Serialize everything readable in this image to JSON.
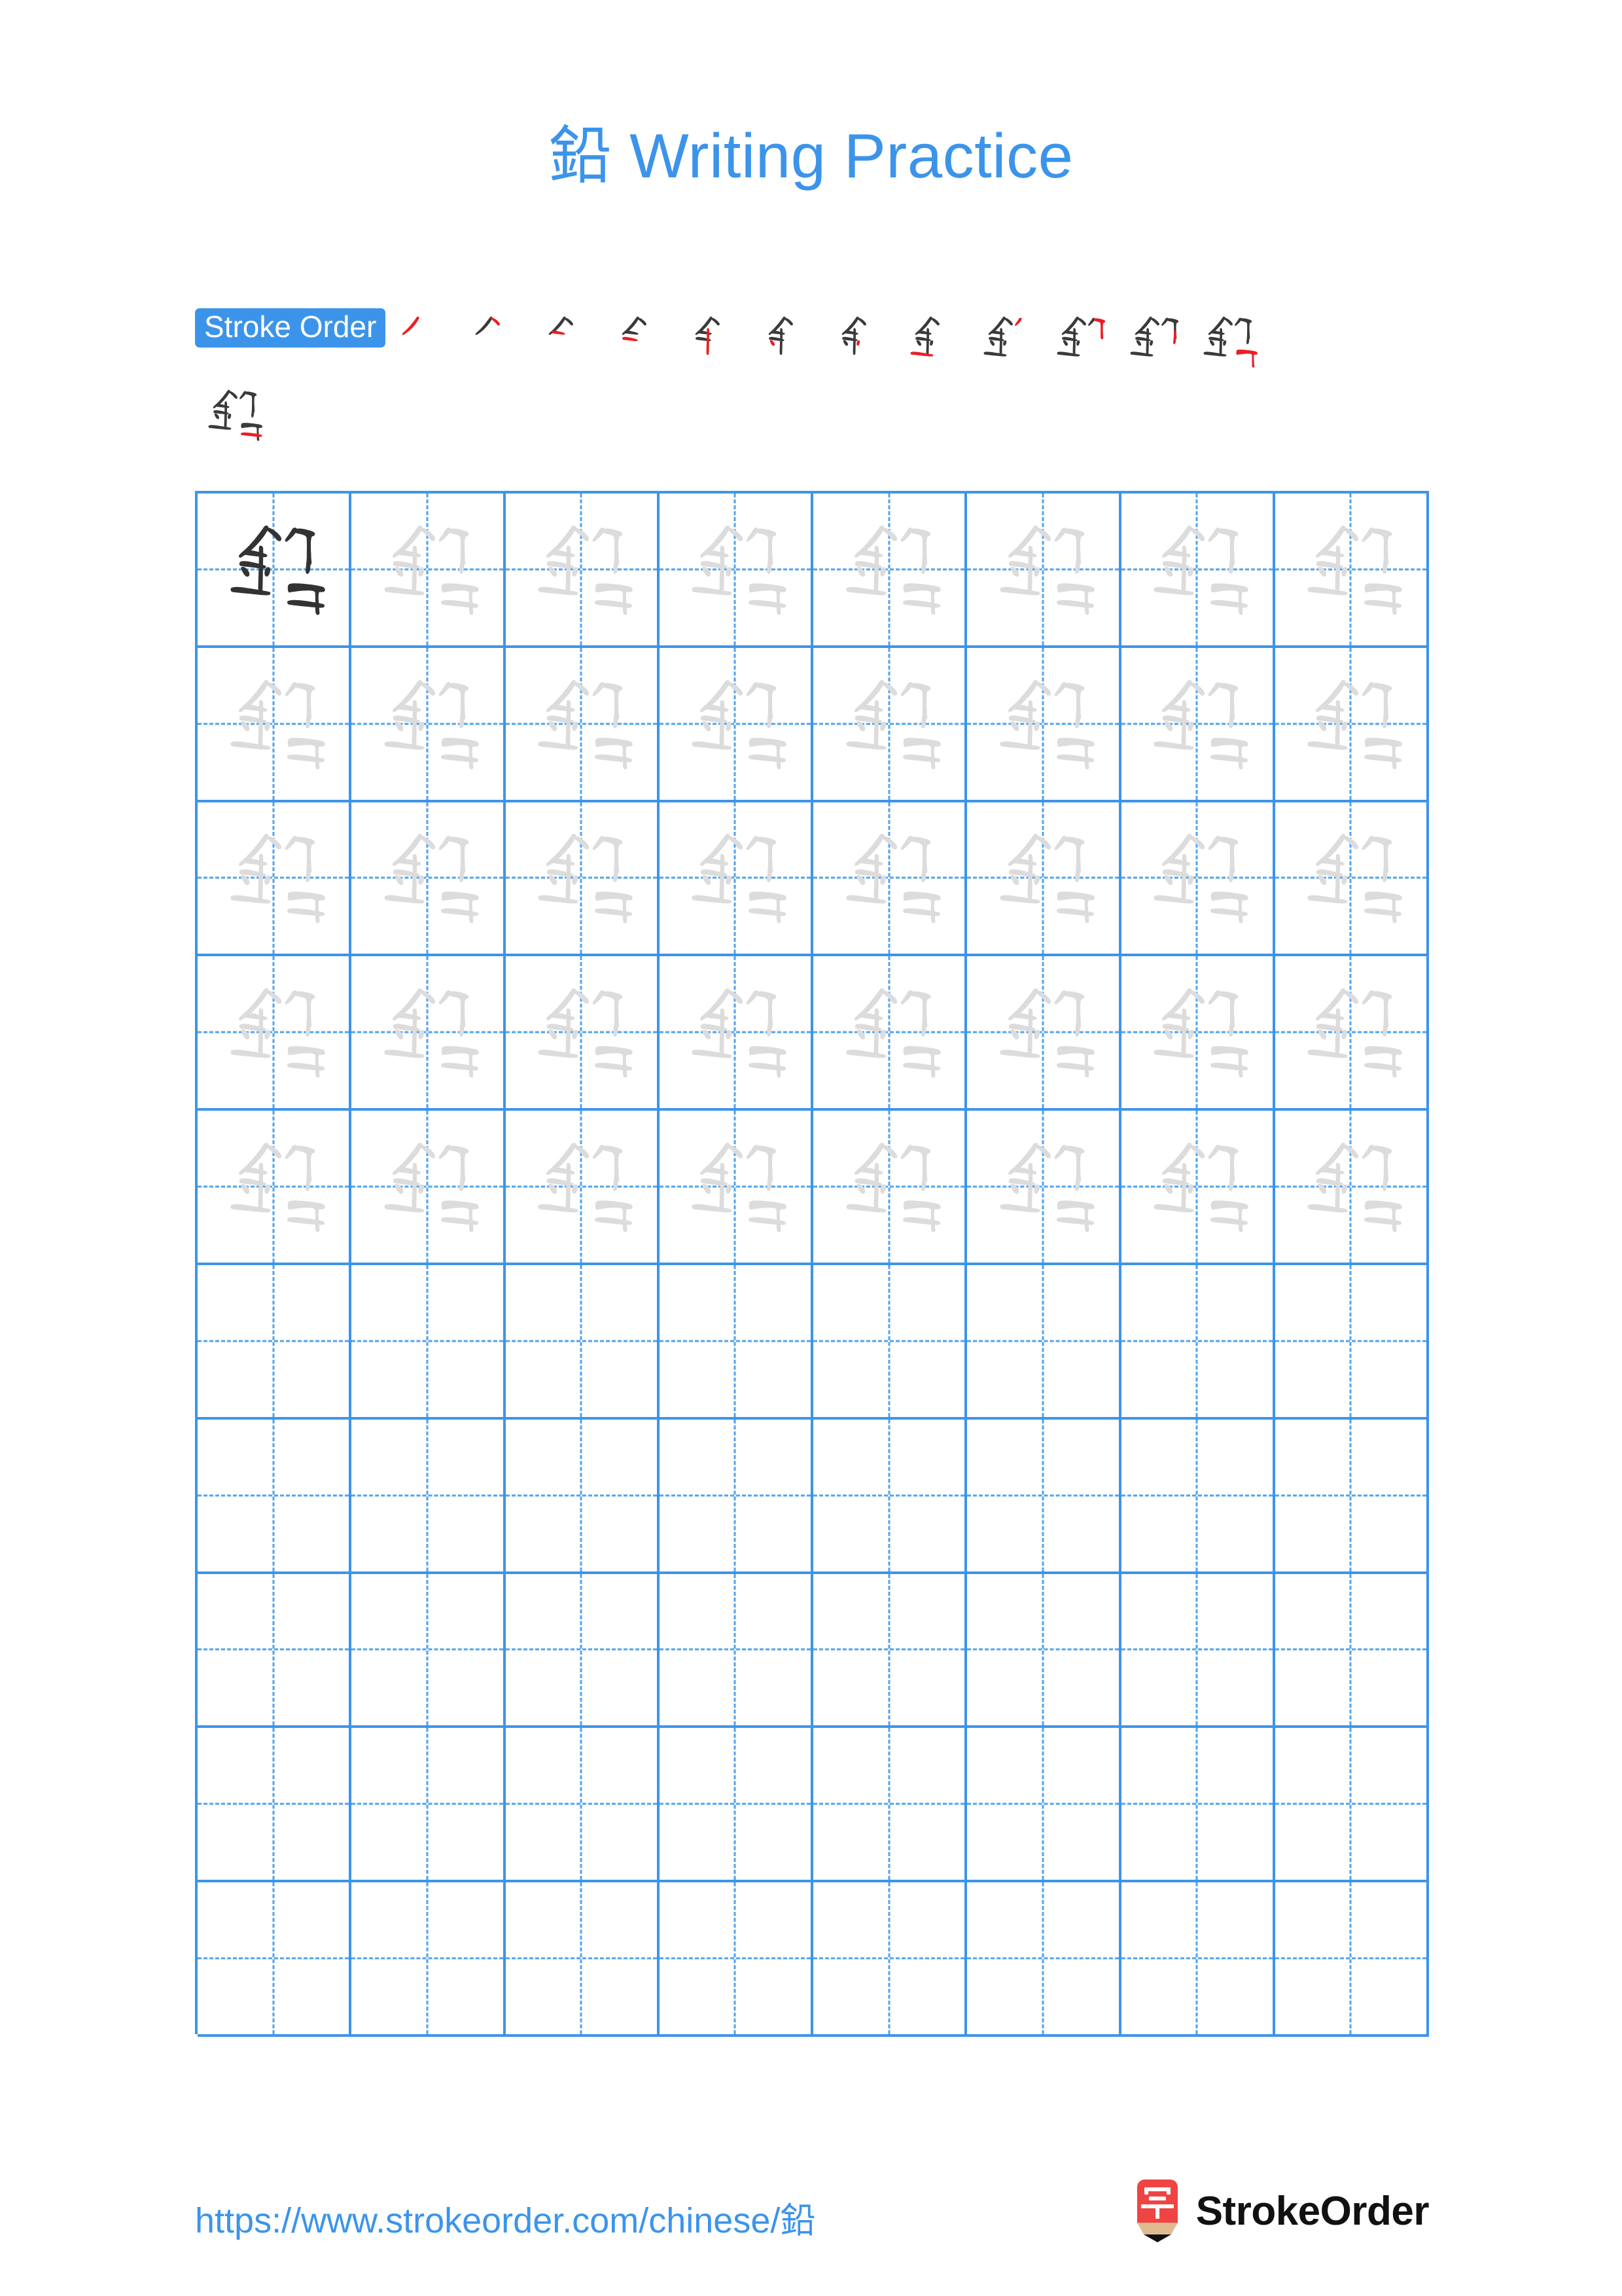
{
  "page": {
    "background": "#ffffff",
    "accent_blue": "#3c94ea",
    "grid_line_blue": "#3c94ea",
    "dash_blue": "#4fa3ef",
    "stroke_new_red": "#ee1c25",
    "stroke_prev_dark": "#3a3a3a",
    "char_dark": "#333333",
    "char_light": "#dcdcdc"
  },
  "header": {
    "title": "鉛 Writing Practice",
    "character": "鉛"
  },
  "stroke_order": {
    "badge_label": "Stroke Order",
    "total_strokes": 13,
    "row1_count": 12,
    "row2_count": 1,
    "steps": [
      1,
      2,
      3,
      4,
      5,
      6,
      7,
      8,
      9,
      10,
      11,
      12,
      13
    ]
  },
  "practice_grid": {
    "rows": 10,
    "columns": 8,
    "character": "鉛",
    "filled_rows": 5,
    "empty_rows": 5,
    "row_styles": [
      [
        "dark",
        "light",
        "light",
        "light",
        "light",
        "light",
        "light",
        "light"
      ],
      [
        "light",
        "light",
        "light",
        "light",
        "light",
        "light",
        "light",
        "light"
      ],
      [
        "light",
        "light",
        "light",
        "light",
        "light",
        "light",
        "light",
        "light"
      ],
      [
        "light",
        "light",
        "light",
        "light",
        "light",
        "light",
        "light",
        "light"
      ],
      [
        "light",
        "light",
        "light",
        "light",
        "light",
        "light",
        "light",
        "light"
      ],
      [
        "empty",
        "empty",
        "empty",
        "empty",
        "empty",
        "empty",
        "empty",
        "empty"
      ],
      [
        "empty",
        "empty",
        "empty",
        "empty",
        "empty",
        "empty",
        "empty",
        "empty"
      ],
      [
        "empty",
        "empty",
        "empty",
        "empty",
        "empty",
        "empty",
        "empty",
        "empty"
      ],
      [
        "empty",
        "empty",
        "empty",
        "empty",
        "empty",
        "empty",
        "empty",
        "empty"
      ],
      [
        "empty",
        "empty",
        "empty",
        "empty",
        "empty",
        "empty",
        "empty",
        "empty"
      ]
    ]
  },
  "footer": {
    "url": "https://www.strokeorder.com/chinese/鉛",
    "logo_text": "StrokeOrder",
    "logo_glyph": "字",
    "logo_body_color": "#ef4444",
    "logo_wood_color": "#e0bb92",
    "logo_tip_color": "#111111"
  }
}
